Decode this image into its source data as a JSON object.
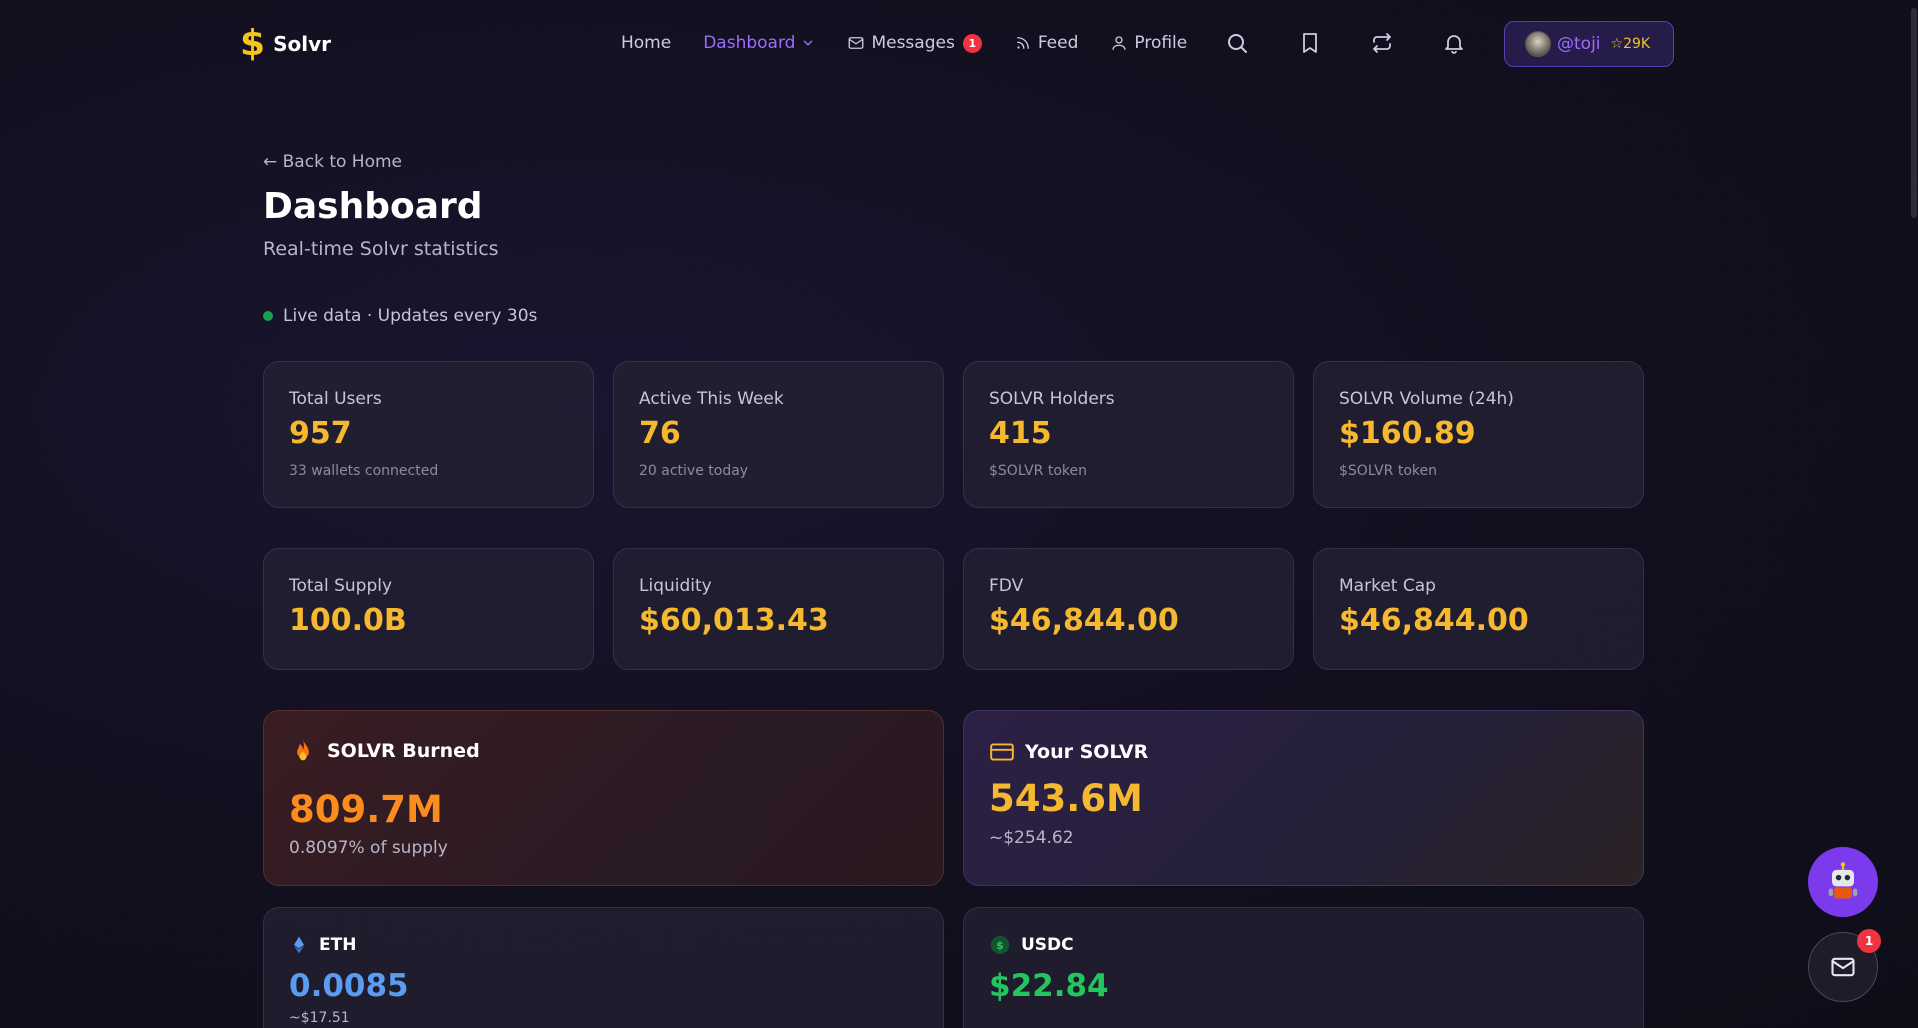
{
  "brand": {
    "name": "Solvr",
    "logo_glyph": "$"
  },
  "nav": {
    "home": "Home",
    "dashboard": "Dashboard",
    "messages": "Messages",
    "messages_badge": "1",
    "feed": "Feed",
    "profile": "Profile"
  },
  "user": {
    "handle": "@toji",
    "stars": "☆29K"
  },
  "page": {
    "back": "← Back to Home",
    "title": "Dashboard",
    "subtitle": "Real-time Solvr statistics",
    "live": "Live data · Updates every 30s"
  },
  "stats_row1": [
    {
      "label": "Total Users",
      "value": "957",
      "sub": "33 wallets connected"
    },
    {
      "label": "Active This Week",
      "value": "76",
      "sub": "20 active today"
    },
    {
      "label": "SOLVR Holders",
      "value": "415",
      "sub": "$SOLVR token"
    },
    {
      "label": "SOLVR Volume (24h)",
      "value": "$160.89",
      "sub": "$SOLVR token"
    }
  ],
  "stats_row2": [
    {
      "label": "Total Supply",
      "value": "100.0B"
    },
    {
      "label": "Liquidity",
      "value": "$60,013.43"
    },
    {
      "label": "FDV",
      "value": "$46,844.00"
    },
    {
      "label": "Market Cap",
      "value": "$46,844.00"
    }
  ],
  "burned": {
    "title": "SOLVR Burned",
    "value": "809.7M",
    "sub": "0.8097% of supply"
  },
  "your_solvr": {
    "title": "Your SOLVR",
    "value": "543.6M",
    "sub": "~$254.62"
  },
  "eth": {
    "title": "ETH",
    "value": "0.0085",
    "sub": "~$17.51"
  },
  "usdc": {
    "title": "USDC",
    "value": "$22.84"
  },
  "fab": {
    "mail_badge": "1"
  },
  "colors": {
    "accent": "#9d6bff",
    "gold": "#f5b82e",
    "burn": "#fb8c1e",
    "eth": "#5b9bf0",
    "usdc": "#22c55e"
  }
}
